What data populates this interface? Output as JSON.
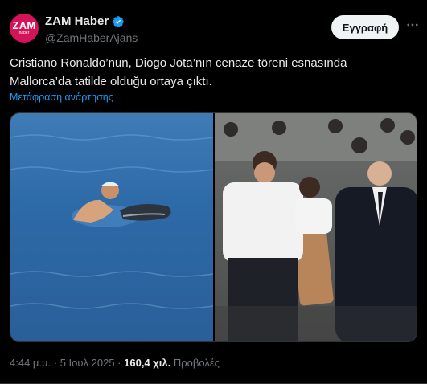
{
  "author": {
    "display_name": "ZAM Haber",
    "handle": "@ZamHaberAjans",
    "avatar_text": "ZAM",
    "avatar_subtext": "haber",
    "avatar_color": "#d4145a",
    "verified": true
  },
  "subscribe_label": "Εγγραφή",
  "tweet": {
    "line1": "Cristiano Ronaldo’nun, Diogo Jota’nın cenaze töreni esnasında",
    "line2": "Mallorca’da tatilde olduğu ortaya çıktı."
  },
  "translate_label": "Μετάφραση ανάρτησης",
  "media": [
    {
      "icon": "photo-sea-swimmer"
    },
    {
      "icon": "photo-funeral-procession"
    }
  ],
  "meta": {
    "time": "4:44 μ.μ.",
    "separator": "·",
    "date": "5 Ιουλ 2025",
    "views_count": "160,4 χιλ.",
    "views_label": "Προβολές"
  },
  "colors": {
    "background": "#000000",
    "text": "#e7e9ea",
    "secondary": "#71767b",
    "link": "#1d9bf0",
    "verified": "#1d9bf0"
  }
}
